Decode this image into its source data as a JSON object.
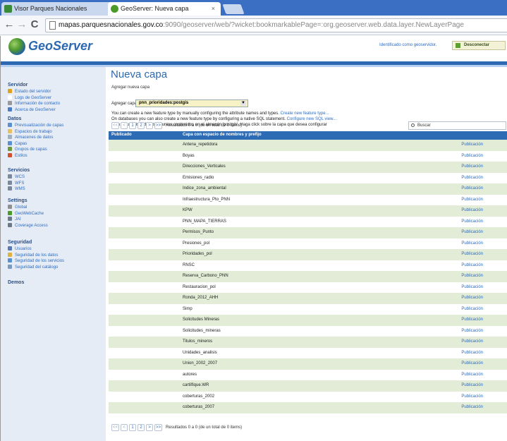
{
  "browser": {
    "tabs": [
      {
        "label": "Visor Parques Nacionales",
        "icon_color": "#3a8a3a"
      },
      {
        "label": "GeoServer: Nueva capa",
        "icon_color": "#4a9a2a"
      }
    ],
    "url_host": "mapas.parquesnacionales.gov.co",
    "url_rest": ":9090/geoserver/web/?wicket:bookmarkablePage=:org.geoserver.web.data.layer.NewLayerPage"
  },
  "header": {
    "logo_text": "GeoServer",
    "logged_in_as": "Identificado como geoservidor.",
    "logout_label": "Desconectar"
  },
  "sidebar": {
    "sections": [
      {
        "title": "Servidor",
        "items": [
          {
            "label": "Estado del servidor",
            "color": "#e0a020"
          },
          {
            "label": "Logs de GeoServer",
            "color": "#ffffff"
          },
          {
            "label": "Información de contacto",
            "color": "#999999"
          },
          {
            "label": "Acerca de GeoServer",
            "color": "#4b7cc4"
          }
        ]
      },
      {
        "title": "Datos",
        "items": [
          {
            "label": "Previsualización de capas",
            "color": "#5a8fd0"
          },
          {
            "label": "Espacios de trabajo",
            "color": "#e8c060"
          },
          {
            "label": "Almacenes de datos",
            "color": "#a0b0c0"
          },
          {
            "label": "Capas",
            "color": "#5a8fd0"
          },
          {
            "label": "Grupos de capas",
            "color": "#6a9a40"
          },
          {
            "label": "Estilos",
            "color": "#d05030"
          }
        ]
      },
      {
        "title": "Servicios",
        "items": [
          {
            "label": "WCS",
            "color": "#7a8a9a"
          },
          {
            "label": "WFS",
            "color": "#7a8a9a"
          },
          {
            "label": "WMS",
            "color": "#7a8a9a"
          }
        ]
      },
      {
        "title": "Settings",
        "items": [
          {
            "label": "Global",
            "color": "#909090"
          },
          {
            "label": "GeoWebCache",
            "color": "#4a9a2a"
          },
          {
            "label": "JAI",
            "color": "#6a7a8a"
          },
          {
            "label": "Coverage Access",
            "color": "#6a7a8a"
          }
        ]
      },
      {
        "title": "Seguridad",
        "items": [
          {
            "label": "Usuarios",
            "color": "#5a7ab0"
          },
          {
            "label": "Seguridad de los datos",
            "color": "#e0b040"
          },
          {
            "label": "Seguridad de los servicios",
            "color": "#5a8fd0"
          },
          {
            "label": "Seguridad del catálogo",
            "color": "#7a9ac0"
          }
        ]
      },
      {
        "title": "Demos",
        "items": []
      }
    ]
  },
  "main": {
    "title": "Nueva capa",
    "subtitle": "Agregar nueva capa",
    "add_label": "Agregar capa de",
    "store_value": "pnn_prioridades:postgis",
    "desc1": "You can create a new feature type by manually configuring the attribute names and types.",
    "desc1_link": "Create new feature type...",
    "desc2": "On databases you can also create a new feature type by configuring a native SQL statement.",
    "desc2_link": "Configure new SQL view...",
    "desc3": "Esta es una lista de los recursos contenidos en el almacén 'postgis'. Haga click sobre la capa que desea configurar",
    "pager": {
      "first": "<<",
      "prev": "<",
      "page1": "1",
      "page2": "2",
      "next": ">",
      "last": ">>",
      "results": "Resultados 0 a 0 (de un total de 0 items)"
    },
    "search_placeholder": "Buscar",
    "table": {
      "col_published": "Publicado",
      "col_name": "Capa con espacio de nombres y prefijo",
      "publish_label": "Publicación",
      "rows": [
        "Antena_repetidora",
        "Boyas",
        "Direcciones_Verticales",
        "Emisiones_radio",
        "Indice_zona_ambiental",
        "Infraestructura_Pto_PNN",
        "KPW",
        "PNN_MAPA_TIERRAS",
        "Permisos_Punto",
        "Presiones_pol",
        "Prioridades_pol",
        "RNSC",
        "Reserva_Carbono_PNN",
        "Restauracion_pol",
        "Ronda_2012_AHH",
        "Simp",
        "Solicitudes Mineras",
        "Solicitudes_mineras",
        "Titulos_mineros",
        "Unidades_analisis",
        "Union_2002_2007",
        "autores",
        "cartilfique.WR",
        "coberturas_2002",
        "coberturas_2007"
      ]
    }
  }
}
